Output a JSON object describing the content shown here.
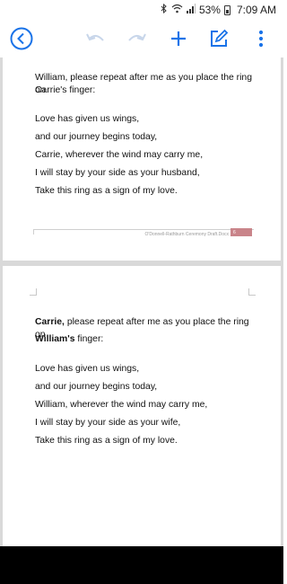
{
  "status_bar": {
    "icons": [
      "bluetooth-icon",
      "wifi-icon",
      "signal-icon",
      "battery-icon"
    ],
    "battery_percent": "53%",
    "time": "7:09 AM"
  },
  "toolbar": {
    "back_icon": "back-circle-icon",
    "undo_icon": "undo-icon",
    "redo_icon": "redo-icon",
    "add_icon": "plus-icon",
    "edit_icon": "edit-icon",
    "more_icon": "more-vert-icon",
    "accent_color": "#1a73e8"
  },
  "page1": {
    "intro_line1": "William, please repeat after me as you place the ring on",
    "intro_line2": "Carrie's finger:",
    "vows": [
      "Love has given us wings,",
      "and our journey begins today,",
      "Carrie, wherever the wind may carry me,",
      "I will stay by your side as your husband,",
      "Take this ring as a sign of my love."
    ],
    "footer_title": "O'Donnell-Rathburn Ceremony Draft.Docx",
    "page_number": "6"
  },
  "page2": {
    "intro_name": "Carrie,",
    "intro_rest": " please repeat after me as you place the ring on",
    "intro_name2": "William's",
    "intro_rest2": " finger:",
    "vows": [
      "Love has given us wings,",
      "and our journey begins today,",
      "William, wherever the wind may carry me,",
      "I will stay by your side as your wife,",
      "Take this ring as a sign of my love."
    ]
  }
}
